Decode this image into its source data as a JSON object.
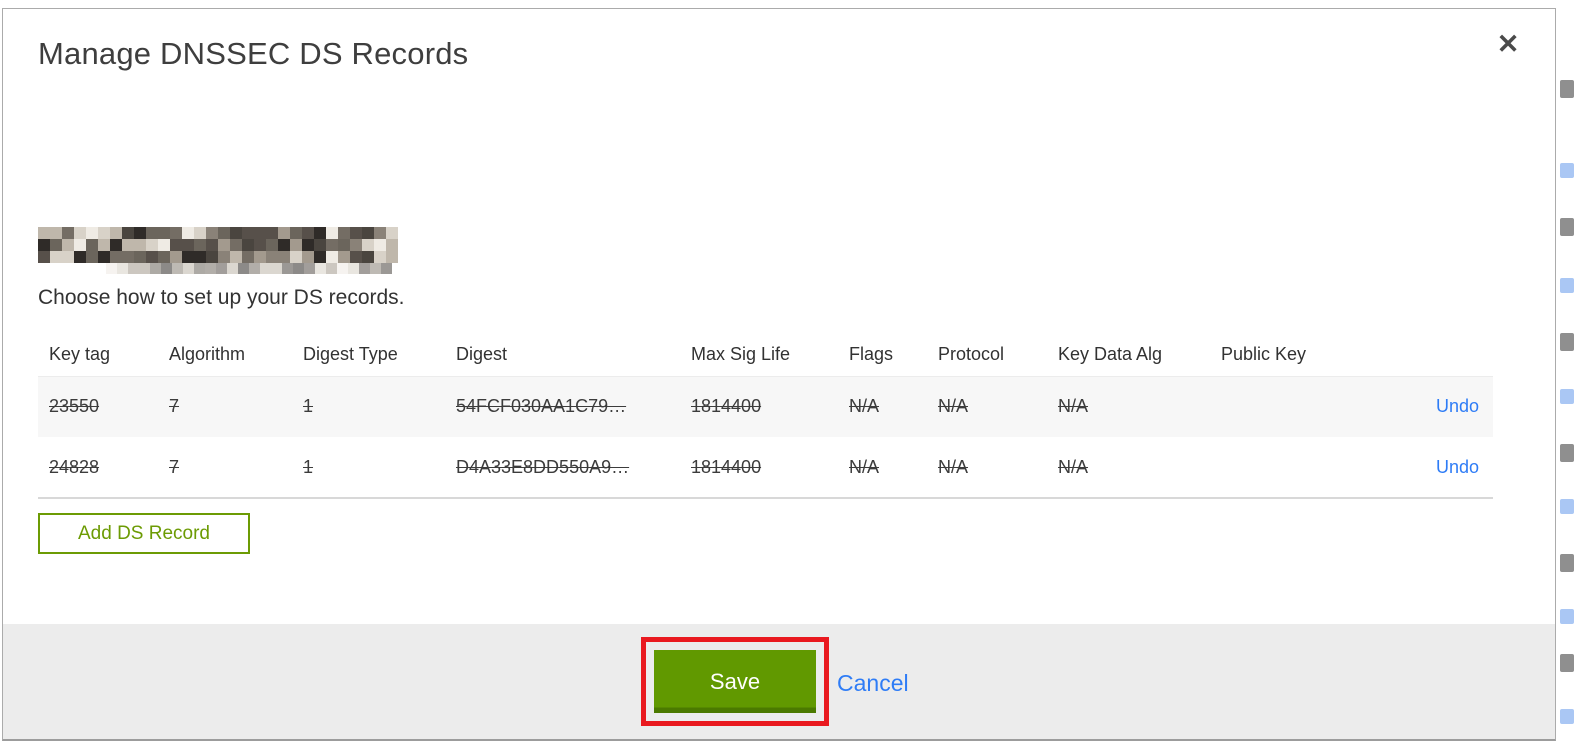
{
  "modal": {
    "title": "Manage DNSSEC DS Records",
    "close_icon": "✕",
    "instruction": "Choose how to set up your DS records.",
    "domain_name_redacted": true
  },
  "table": {
    "headers": [
      "Key tag",
      "Algorithm",
      "Digest Type",
      "Digest",
      "Max Sig Life",
      "Flags",
      "Protocol",
      "Key Data Alg",
      "Public Key"
    ],
    "rows": [
      {
        "key_tag": "23550",
        "algorithm": "7",
        "digest_type": "1",
        "digest": "54FCF030AA1C79…",
        "max_sig_life": "1814400",
        "flags": "N/A",
        "protocol": "N/A",
        "key_data_alg": "N/A",
        "public_key": "",
        "undo_label": "Undo",
        "deleted": true
      },
      {
        "key_tag": "24828",
        "algorithm": "7",
        "digest_type": "1",
        "digest": "D4A33E8DD550A9…",
        "max_sig_life": "1814400",
        "flags": "N/A",
        "protocol": "N/A",
        "key_data_alg": "N/A",
        "public_key": "",
        "undo_label": "Undo",
        "deleted": true
      }
    ]
  },
  "actions": {
    "add_record": "Add DS Record",
    "save": "Save",
    "cancel": "Cancel"
  },
  "colors": {
    "save_green": "#619900",
    "outline_green": "#6c9b04",
    "link_blue": "#2e7cf6",
    "annotation_red": "#e9191f",
    "footer_gray": "#ececec",
    "row_shade_gray": "#f7f7f7",
    "title_gray": "#3e3e3e"
  }
}
